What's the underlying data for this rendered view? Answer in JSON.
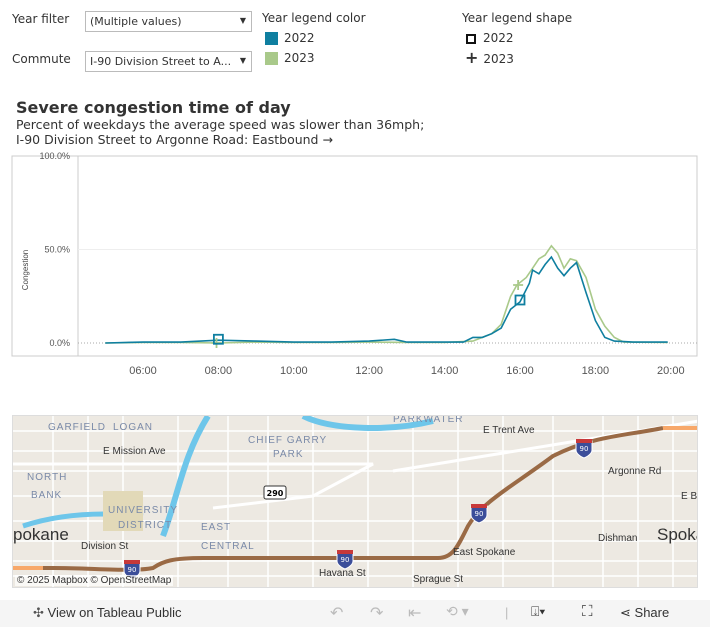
{
  "filters": {
    "year_filter": {
      "label": "Year filter",
      "value": "(Multiple values)"
    },
    "commute": {
      "label": "Commute",
      "value": "I-90 Division Street to A..."
    }
  },
  "legend_color": {
    "title": "Year legend color",
    "items": [
      {
        "label": "2022",
        "color": "#0f7fa0"
      },
      {
        "label": "2023",
        "color": "#a9c98a"
      }
    ]
  },
  "legend_shape": {
    "title": "Year legend shape",
    "items": [
      {
        "label": "2022",
        "shape": "square"
      },
      {
        "label": "2023",
        "shape": "plus"
      }
    ]
  },
  "chart": {
    "title": "Severe congestion time of day",
    "subtitle1": "Percent of weekdays the average speed was slower than 36mph;",
    "subtitle2": "I-90 Division Street to Argonne Road: Eastbound →"
  },
  "chart_data": {
    "type": "line",
    "ylabel": "Congestion",
    "yticks": [
      "0.0%",
      "50.0%",
      "100.0%"
    ],
    "ylim": [
      0,
      100
    ],
    "xticks": [
      "06:00",
      "08:00",
      "10:00",
      "12:00",
      "14:00",
      "16:00",
      "18:00",
      "20:00"
    ],
    "xlim": [
      "04:30",
      "20:40"
    ],
    "grid": "horizontal",
    "series": [
      {
        "name": "2022",
        "color": "#0f7fa0",
        "marker": "square",
        "marker_points": [
          [
            "08:00",
            2
          ],
          [
            "16:00",
            23
          ]
        ],
        "points": [
          [
            "05:00",
            0
          ],
          [
            "06:00",
            0.5
          ],
          [
            "07:00",
            0.5
          ],
          [
            "08:00",
            1.5
          ],
          [
            "09:00",
            1
          ],
          [
            "10:00",
            0.5
          ],
          [
            "11:00",
            0.5
          ],
          [
            "12:00",
            1
          ],
          [
            "12:40",
            2
          ],
          [
            "13:00",
            0.5
          ],
          [
            "14:00",
            0.5
          ],
          [
            "14:30",
            0.5
          ],
          [
            "14:45",
            3
          ],
          [
            "15:00",
            3
          ],
          [
            "15:15",
            5
          ],
          [
            "15:30",
            8
          ],
          [
            "15:45",
            18
          ],
          [
            "16:00",
            22
          ],
          [
            "16:15",
            32
          ],
          [
            "16:20",
            39
          ],
          [
            "16:30",
            37
          ],
          [
            "16:40",
            42
          ],
          [
            "16:50",
            46
          ],
          [
            "17:00",
            40
          ],
          [
            "17:10",
            36
          ],
          [
            "17:20",
            40
          ],
          [
            "17:30",
            43
          ],
          [
            "17:45",
            27
          ],
          [
            "18:00",
            12
          ],
          [
            "18:15",
            3
          ],
          [
            "18:30",
            1
          ],
          [
            "19:00",
            0.5
          ],
          [
            "19:55",
            0.5
          ]
        ]
      },
      {
        "name": "2023",
        "color": "#a9c98a",
        "marker": "plus",
        "marker_points": [
          [
            "07:57",
            0
          ],
          [
            "15:57",
            31
          ]
        ],
        "points": [
          [
            "05:00",
            0
          ],
          [
            "06:00",
            0.3
          ],
          [
            "07:00",
            0.3
          ],
          [
            "08:00",
            0
          ],
          [
            "09:00",
            0.5
          ],
          [
            "10:00",
            0.3
          ],
          [
            "11:00",
            0.3
          ],
          [
            "12:00",
            0.5
          ],
          [
            "13:00",
            0.3
          ],
          [
            "14:00",
            0.3
          ],
          [
            "14:45",
            1
          ],
          [
            "15:00",
            3
          ],
          [
            "15:15",
            5
          ],
          [
            "15:30",
            10
          ],
          [
            "15:45",
            25
          ],
          [
            "15:55",
            31
          ],
          [
            "16:10",
            35
          ],
          [
            "16:20",
            40
          ],
          [
            "16:30",
            45
          ],
          [
            "16:40",
            47
          ],
          [
            "16:50",
            52
          ],
          [
            "17:00",
            48
          ],
          [
            "17:10",
            40
          ],
          [
            "17:20",
            45
          ],
          [
            "17:30",
            44
          ],
          [
            "17:45",
            35
          ],
          [
            "18:00",
            18
          ],
          [
            "18:15",
            9
          ],
          [
            "18:30",
            3
          ],
          [
            "18:45",
            0.5
          ],
          [
            "19:55",
            0.3
          ]
        ]
      }
    ]
  },
  "map": {
    "labels": [
      "GARFIELD",
      "LOGAN",
      "CHIEF GARRY",
      "PARK",
      "PARKWATER",
      "E Trent Ave",
      "E Mission Ave",
      "NORTH",
      "BANK",
      "UNIVERSITY",
      "DISTRICT",
      "EAST",
      "CENTRAL",
      "pokane",
      "Division St",
      "Havana St",
      "East Spokane",
      "Sprague St",
      "Argonne Rd",
      "Dishman",
      "Spoka",
      "E B"
    ],
    "shields": [
      "290",
      "90"
    ],
    "attribution": "© 2025 Mapbox © OpenStreetMap",
    "route_color": "#9a6a45"
  },
  "toolbar": {
    "view_label": "View on Tableau Public",
    "share_label": "Share"
  }
}
